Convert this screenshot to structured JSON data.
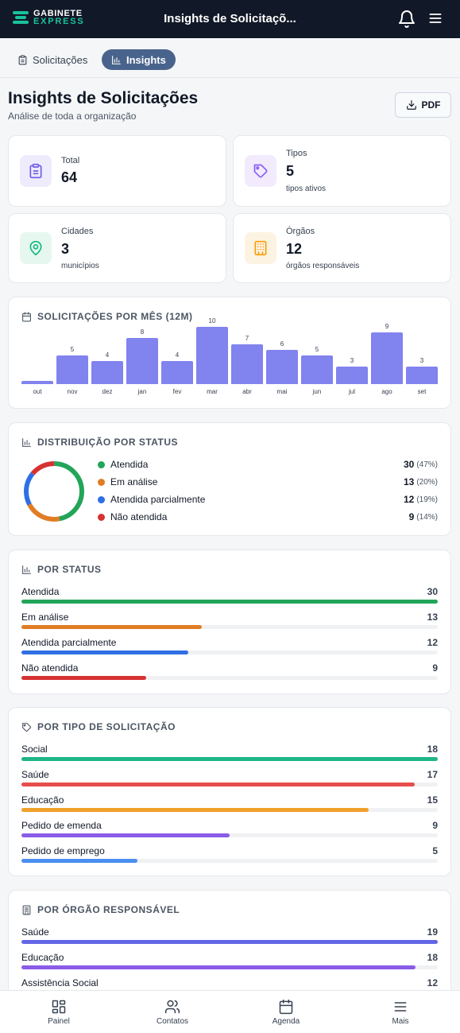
{
  "app": {
    "logo_top": "GABINETE",
    "logo_bottom": "EXPRESS",
    "title": "Insights de Solicitaçõ..."
  },
  "icons": {
    "bell": "bell-icon",
    "menu": "hamburger-icon",
    "tab_requests": "clipboard-icon",
    "tab_insights": "bar-chart-icon",
    "pdf": "download-icon"
  },
  "tabs": [
    {
      "label": "Solicitações",
      "active": false
    },
    {
      "label": "Insights",
      "active": true
    }
  ],
  "page": {
    "title": "Insights de Solicitações",
    "subtitle": "Análise de toda a organização",
    "pdf_label": "PDF"
  },
  "stats": [
    {
      "label": "Total",
      "value": "64",
      "sub": "",
      "icon": "clipboard-icon",
      "color": "#6d5ce8",
      "bg": "#eeebfd"
    },
    {
      "label": "Tipos",
      "value": "5",
      "sub": "tipos ativos",
      "icon": "tag-icon",
      "color": "#8b5cf6",
      "bg": "#f1ebfd"
    },
    {
      "label": "Cidades",
      "value": "3",
      "sub": "municípios",
      "icon": "map-pin-icon",
      "color": "#10b981",
      "bg": "#e6f7f0"
    },
    {
      "label": "Órgãos",
      "value": "12",
      "sub": "órgãos responsáveis",
      "icon": "building-icon",
      "color": "#f59e0b",
      "bg": "#fdf3e2"
    }
  ],
  "monthly": {
    "title": "SOLICITAÇÕES POR MÊS (12M)",
    "chart_data": {
      "type": "bar",
      "categories": [
        "out",
        "nov",
        "dez",
        "jan",
        "fev",
        "mar",
        "abr",
        "mai",
        "jun",
        "jul",
        "ago",
        "set"
      ],
      "values": [
        0,
        5,
        4,
        8,
        4,
        10,
        7,
        6,
        5,
        3,
        9,
        3
      ],
      "value_labels": [
        "",
        "5",
        "4",
        "8",
        "4",
        "10",
        "7",
        "6",
        "5",
        "3",
        "9",
        "3"
      ],
      "color": "#8183ee"
    }
  },
  "distribution": {
    "title": "DISTRIBUIÇÃO POR STATUS",
    "items": [
      {
        "name": "Atendida",
        "value": "30",
        "pct": "(47%)",
        "n": 30,
        "color": "#22a559"
      },
      {
        "name": "Em análise",
        "value": "13",
        "pct": "(20%)",
        "n": 13,
        "color": "#e07d24"
      },
      {
        "name": "Atendida parcialmente",
        "value": "12",
        "pct": "(19%)",
        "n": 12,
        "color": "#2f6fe4"
      },
      {
        "name": "Não atendida",
        "value": "9",
        "pct": "(14%)",
        "n": 9,
        "color": "#d63232"
      }
    ]
  },
  "by_status": {
    "title": "POR STATUS",
    "max": 30,
    "items": [
      {
        "name": "Atendida",
        "value": "30",
        "n": 30,
        "color": "#22a559"
      },
      {
        "name": "Em análise",
        "value": "13",
        "n": 13,
        "color": "#e07d24"
      },
      {
        "name": "Atendida parcialmente",
        "value": "12",
        "n": 12,
        "color": "#2f6fe4"
      },
      {
        "name": "Não atendida",
        "value": "9",
        "n": 9,
        "color": "#d63232"
      }
    ]
  },
  "by_type": {
    "title": "POR TIPO DE SOLICITAÇÃO",
    "max": 18,
    "items": [
      {
        "name": "Social",
        "value": "18",
        "n": 18,
        "color": "#1fb589"
      },
      {
        "name": "Saúde",
        "value": "17",
        "n": 17,
        "color": "#e74d4d"
      },
      {
        "name": "Educação",
        "value": "15",
        "n": 15,
        "color": "#f0a02a"
      },
      {
        "name": "Pedido de emenda",
        "value": "9",
        "n": 9,
        "color": "#8a5ce8"
      },
      {
        "name": "Pedido de emprego",
        "value": "5",
        "n": 5,
        "color": "#4a8ff0"
      }
    ]
  },
  "by_org": {
    "title": "POR ÓRGÃO RESPONSÁVEL",
    "max": 19,
    "items": [
      {
        "name": "Saúde",
        "value": "19",
        "n": 19,
        "color": "#6366e6"
      },
      {
        "name": "Educação",
        "value": "18",
        "n": 18,
        "color": "#8a5ce8"
      },
      {
        "name": "Assistência Social",
        "value": "12",
        "n": 12,
        "color": "#f0a02a"
      }
    ]
  },
  "nav": [
    {
      "label": "Painel",
      "icon": "grid-icon"
    },
    {
      "label": "Contatos",
      "icon": "users-icon"
    },
    {
      "label": "Agenda",
      "icon": "calendar-icon"
    },
    {
      "label": "Mais",
      "icon": "menu-icon"
    }
  ]
}
